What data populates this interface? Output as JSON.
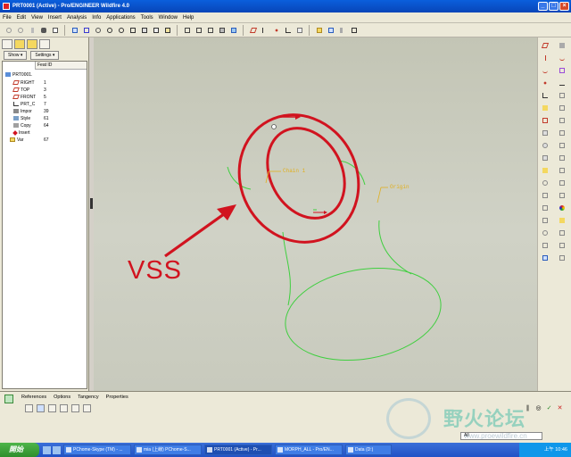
{
  "window": {
    "title": "PRT0001 (Active) - Pro/ENGINEER Wildfire 4.0"
  },
  "menu": [
    "File",
    "Edit",
    "View",
    "Insert",
    "Analysis",
    "Info",
    "Applications",
    "Tools",
    "Window",
    "Help"
  ],
  "model_tree": {
    "show_label": "Show ▾",
    "settings_label": "Settings ▾",
    "column_header": "Feat ID",
    "items": [
      {
        "label": "PRT0001.",
        "id": ""
      },
      {
        "label": "RIGHT",
        "id": "1"
      },
      {
        "label": "TOP",
        "id": "3"
      },
      {
        "label": "FRONT",
        "id": "5"
      },
      {
        "label": "PRT_C",
        "id": "7"
      },
      {
        "label": "Impor",
        "id": "39"
      },
      {
        "label": "Style",
        "id": "61"
      },
      {
        "label": "Copy",
        "id": "64"
      },
      {
        "label": "Insert",
        "id": ""
      },
      {
        "label": "Var",
        "id": "67"
      }
    ]
  },
  "viewport": {
    "annotation": "VSS",
    "labels": {
      "chain": "Chain 1",
      "origin": "Origin"
    }
  },
  "dashboard": {
    "tabs": [
      "References",
      "Options",
      "Tangency",
      "Properties"
    ],
    "filter_value": "All"
  },
  "watermark": {
    "text": "野火论坛",
    "url": "www.proewildfire.cn"
  },
  "taskbar": {
    "start": "開始",
    "tasks": [
      "PChome-Skype (TM) - ...",
      "mia (上線) PChome-S...",
      "PRT0001 (Active) - Pr...",
      "MORPH_ALL - Pro/EN...",
      "Data (D:)"
    ],
    "clock": "上午 10:46"
  },
  "colors": {
    "accent_red": "#d1131f",
    "curve_green": "#3fcf3f",
    "title_blue": "#0a5fdc"
  }
}
